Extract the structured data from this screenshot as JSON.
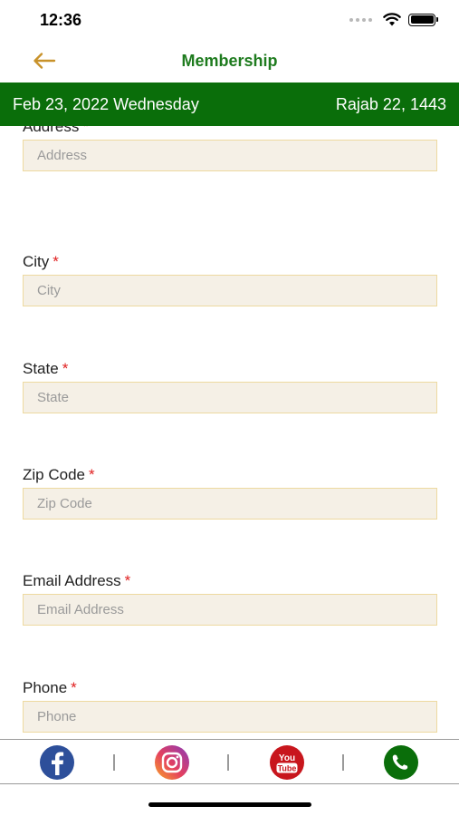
{
  "status": {
    "time": "12:36"
  },
  "nav": {
    "title": "Membership"
  },
  "date_bar": {
    "gregorian": "Feb 23, 2022 Wednesday",
    "hijri": "Rajab 22, 1443"
  },
  "form": {
    "required_mark": "*",
    "fields": [
      {
        "label": "Address",
        "placeholder": "Address",
        "value": ""
      },
      {
        "label": "City",
        "placeholder": "City",
        "value": ""
      },
      {
        "label": "State",
        "placeholder": "State",
        "value": ""
      },
      {
        "label": "Zip Code",
        "placeholder": "Zip Code",
        "value": ""
      },
      {
        "label": "Email Address",
        "placeholder": "Email Address",
        "value": ""
      },
      {
        "label": "Phone",
        "placeholder": "Phone",
        "value": ""
      }
    ]
  },
  "social": {
    "items": [
      "facebook-icon",
      "instagram-icon",
      "youtube-icon",
      "phone-icon"
    ],
    "youtube_text_1": "You",
    "youtube_text_2": "Tube"
  },
  "colors": {
    "accent_green": "#0a6e0a",
    "title_green": "#1e7b1e",
    "back_arrow": "#c8922a",
    "input_bg": "#f5f0e6",
    "input_border": "#edd9a0",
    "required": "#e02020"
  }
}
